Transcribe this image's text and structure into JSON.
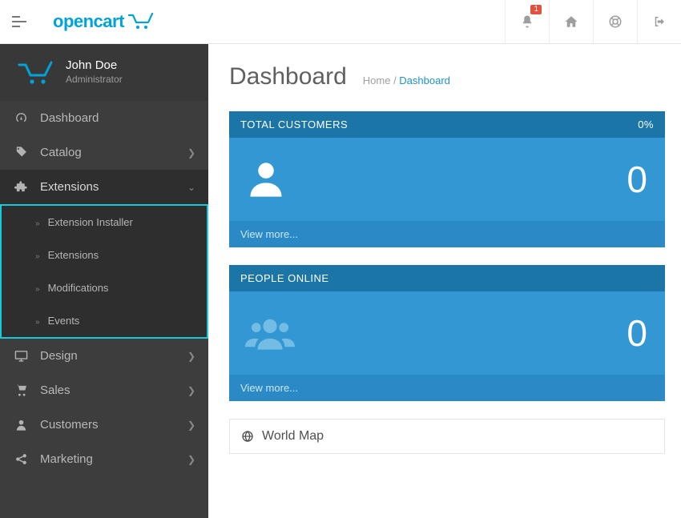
{
  "header": {
    "logo_text": "opencart",
    "notification_count": "1"
  },
  "user": {
    "name": "John Doe",
    "role": "Administrator"
  },
  "sidebar": {
    "dashboard": "Dashboard",
    "catalog": "Catalog",
    "extensions": "Extensions",
    "ext_installer": "Extension Installer",
    "ext_extensions": "Extensions",
    "ext_modifications": "Modifications",
    "ext_events": "Events",
    "design": "Design",
    "sales": "Sales",
    "customers": "Customers",
    "marketing": "Marketing"
  },
  "page": {
    "title": "Dashboard",
    "crumb_home": "Home",
    "crumb_current": "Dashboard",
    "sep": " / "
  },
  "cards": {
    "customers": {
      "title": "TOTAL CUSTOMERS",
      "percent": "0%",
      "value": "0",
      "more": "View more..."
    },
    "online": {
      "title": "PEOPLE ONLINE",
      "value": "0",
      "more": "View more..."
    },
    "map": {
      "title": "World Map"
    }
  }
}
